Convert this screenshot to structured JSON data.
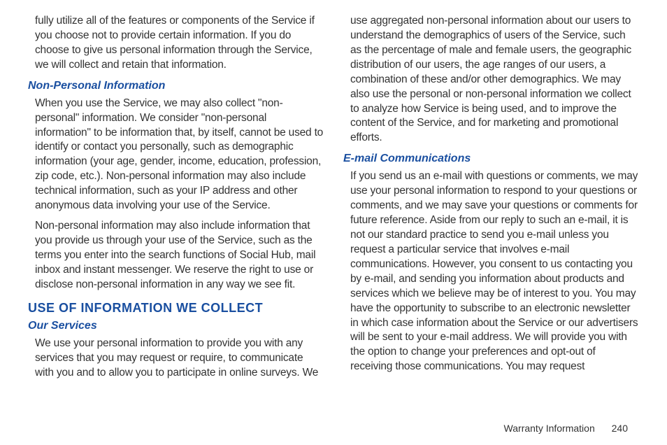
{
  "column1": {
    "p1": "fully utilize all of the features or components of the Service if you choose not to provide certain information. If you do choose to give us personal information through the Service, we will collect and retain that information.",
    "h1": "Non-Personal Information",
    "p2": "When you use the Service, we may also collect \"non-personal\" information. We consider \"non-personal information\" to be information that, by itself, cannot be used to identify or contact you personally, such as demographic information (your age, gender, income, education, profession, zip code, etc.). Non-personal information may also include technical information, such as your IP address and other anonymous data involving your use of the Service.",
    "p3": "Non-personal information may also include information that you provide us through your use of the Service, such as the terms you enter into the search functions of Social Hub, mail inbox and instant messenger. We reserve the right to use or disclose non-personal information in any way we see fit.",
    "h2": "USE OF INFORMATION WE COLLECT",
    "h3": "Our Services",
    "p4": "We use your personal information to provide you with any services that you may request or require, to communicate with you and to allow you to participate in online surveys. We"
  },
  "column2": {
    "p1": "use aggregated non-personal information about our users to understand the demographics of users of the Service, such as the percentage of male and female users, the geographic distribution of our users, the age ranges of our users, a combination of these and/or other demographics. We may also use the personal or non-personal information we collect to analyze how Service is being used, and to improve the content of the Service, and for marketing and promotional efforts.",
    "h1": "E-mail Communications",
    "p2": "If you send us an e-mail with questions or comments, we may use your personal information to respond to your questions or comments, and we may save your questions or comments for future reference. Aside from our reply to such an e-mail, it is not our standard practice to send you e-mail unless you request a particular service that involves e-mail communications. However, you consent to us contacting you by e-mail, and sending you information about products and services which we believe may be of interest to you. You may have the opportunity to subscribe to an electronic newsletter in which case information about the Service or our advertisers will be sent to your e-mail address. We will provide you with the option to change your preferences and opt-out of receiving those communications. You may request"
  },
  "footer": {
    "section": "Warranty Information",
    "page": "240"
  }
}
